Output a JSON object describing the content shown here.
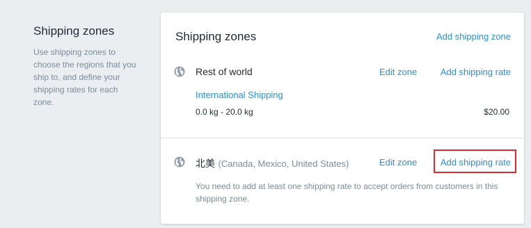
{
  "aside": {
    "title": "Shipping zones",
    "description": "Use shipping zones to choose the regions that you ship to, and define your shipping rates for each zone."
  },
  "card": {
    "title": "Shipping zones",
    "add_zone_label": "Add shipping zone"
  },
  "zones": [
    {
      "name": "Rest of world",
      "edit_label": "Edit zone",
      "add_rate_label": "Add shipping rate",
      "icon": "globe-icon",
      "rates": [
        {
          "name": "International Shipping",
          "condition": "0.0 kg - 20.0 kg",
          "price": "$20.00"
        }
      ]
    },
    {
      "name": "北美",
      "countries": "(Canada, Mexico, United States)",
      "edit_label": "Edit zone",
      "add_rate_label": "Add shipping rate",
      "icon": "globe-icon",
      "warning": "You need to add at least one shipping rate to accept orders from customers in this shipping zone."
    }
  ],
  "colors": {
    "link": "#2d8ed4",
    "highlight": "#e0282f",
    "muted": "#798c9c"
  }
}
